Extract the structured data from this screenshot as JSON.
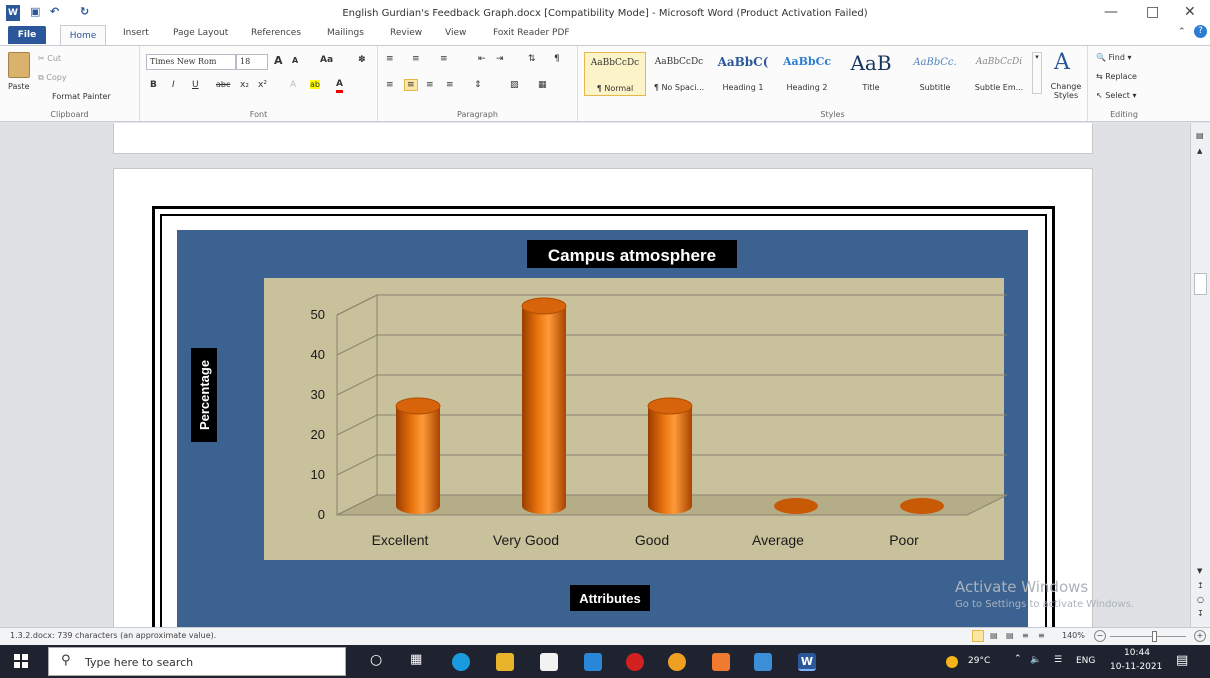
{
  "window": {
    "title": "English Gurdian's Feedback Graph.docx [Compatibility Mode] - Microsoft Word (Product Activation Failed)",
    "minimize_icon": "minimize-icon",
    "maximize_icon": "restore-icon",
    "close_icon": "close-icon"
  },
  "tabs": [
    "File",
    "Home",
    "Insert",
    "Page Layout",
    "References",
    "Mailings",
    "Review",
    "View",
    "Foxit Reader PDF"
  ],
  "ribbon": {
    "clipboard": {
      "paste": "Paste",
      "cut": "Cut",
      "copy": "Copy",
      "format_painter": "Format Painter",
      "label": "Clipboard"
    },
    "font": {
      "name": "Times New Rom",
      "size": "18",
      "label": "Font",
      "bold": "B",
      "italic": "I",
      "underline": "U",
      "grow": "A",
      "shrink": "A",
      "change_case": "Aa",
      "font_color": "A"
    },
    "paragraph": {
      "label": "Paragraph"
    },
    "styles": {
      "label": "Styles",
      "items": [
        {
          "preview": "AaBbCcDc",
          "name": "¶ Normal"
        },
        {
          "preview": "AaBbCcDc",
          "name": "¶ No Spaci..."
        },
        {
          "preview": "AaBbC(",
          "name": "Heading 1"
        },
        {
          "preview": "AaBbCc",
          "name": "Heading 2"
        },
        {
          "preview": "AaB",
          "name": "Title"
        },
        {
          "preview": "AaBbCc.",
          "name": "Subtitle"
        },
        {
          "preview": "AaBbCcDi",
          "name": "Subtle Em..."
        }
      ],
      "change_styles": "Change Styles"
    },
    "editing": {
      "find": "Find",
      "replace": "Replace",
      "select": "Select",
      "label": "Editing"
    }
  },
  "chart_data": {
    "type": "bar",
    "title": "Campus atmosphere",
    "xlabel": "Attributes",
    "ylabel": "Percentage",
    "categories": [
      "Excellent",
      "Very Good",
      "Good",
      "Average",
      "Poor"
    ],
    "values": [
      25,
      50,
      25,
      0,
      0
    ],
    "ylim": [
      0,
      50
    ],
    "yticks": [
      0,
      10,
      20,
      30,
      40,
      50
    ],
    "grid": true,
    "legend": "none",
    "bar_color": "#e8720c",
    "plot_background": "#c9c19b",
    "chart_background": "#3b6291",
    "style": "3d-cylinder"
  },
  "watermark": {
    "line1": "Activate Windows",
    "line2": "Go to Settings to activate Windows."
  },
  "status": {
    "text": "1.3.2.docx: 739 characters (an approximate value).",
    "zoom": "140%"
  },
  "taskbar": {
    "search_placeholder": "Type here to search",
    "temperature": "29°C",
    "language": "ENG",
    "time": "10:44",
    "date": "10-11-2021"
  }
}
